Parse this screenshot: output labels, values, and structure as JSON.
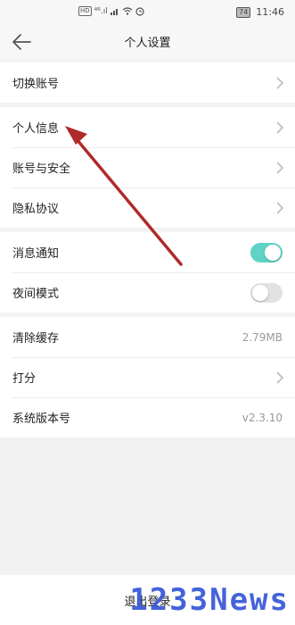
{
  "status_bar": {
    "hd": "HD",
    "signal": "⁴⁶.ıl",
    "battery": "74",
    "time": "11:46"
  },
  "nav": {
    "title": "个人设置",
    "back_icon": "arrow-left-icon"
  },
  "group1": [
    {
      "label": "切换账号",
      "icon": "chevron-right-icon"
    }
  ],
  "group2": [
    {
      "label": "个人信息",
      "icon": "chevron-right-icon"
    },
    {
      "label": "账号与安全",
      "icon": "chevron-right-icon"
    },
    {
      "label": "隐私协议",
      "icon": "chevron-right-icon"
    }
  ],
  "group3": [
    {
      "label": "消息通知",
      "toggle": "on"
    },
    {
      "label": "夜间模式",
      "toggle": "off"
    }
  ],
  "group4": [
    {
      "label": "清除缓存",
      "value": "2.79MB"
    },
    {
      "label": "打分",
      "icon": "chevron-right-icon"
    },
    {
      "label": "系统版本号",
      "value": "v2.3.10"
    }
  ],
  "logout": {
    "label": "退出登录"
  },
  "watermark": "1233News",
  "colors": {
    "toggle_on": "#5fd3c6",
    "arrow": "#b02a2a",
    "watermark": "#3b5bd9"
  }
}
